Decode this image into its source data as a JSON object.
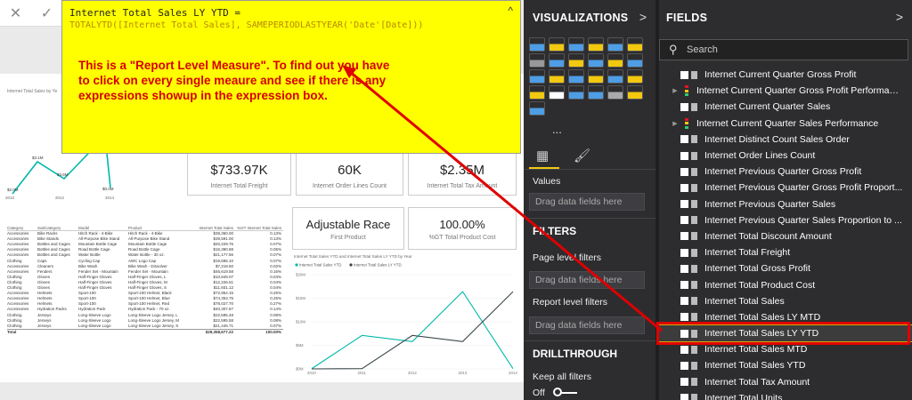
{
  "formula_bar": {
    "cancel_icon": "✕",
    "commit_icon": "✓",
    "line1": "Internet Total Sales LY YTD =",
    "line2": "TOTALYTD([Internet Total Sales], SAMEPERIODLASTYEAR('Date'[Date]))",
    "collapse_icon": "^"
  },
  "annotation": "This is a \"Report Level Measure\". To find out you have to click on every single meaure and see if there is any expressions showup in the expression box.",
  "cards": [
    {
      "value": "$733.97K",
      "caption": "Internet Total Freight"
    },
    {
      "value": "60K",
      "caption": "Internet Order Lines Count"
    },
    {
      "value": "$2.35M",
      "caption": "Internet Total Tax Amount"
    },
    {
      "value": "Adjustable Race",
      "caption": "First Product"
    },
    {
      "value": "100.00%",
      "caption": "%GT Total Product Cost"
    }
  ],
  "small_chart": {
    "title": "Internet Total Sales by Ye",
    "labels": [
      "$2.0M",
      "$3.1M",
      "$3.6M",
      "$0.0M"
    ],
    "years": [
      "2010",
      "2012",
      "2014"
    ]
  },
  "table": {
    "headers": [
      "Category",
      "SubCategory",
      "Model",
      "Product",
      "Internet Total Sales",
      "%GT Internet Total Sales"
    ],
    "rows": [
      [
        "Accessories",
        "Bike Racks",
        "Hitch Rack - 4-Bike",
        "Hitch Rack - 4-Bike",
        "$39,360.00",
        "0.13%"
      ],
      [
        "Accessories",
        "Bike Stands",
        "All-Purpose Bike Stand",
        "All-Purpose Bike Stand",
        "$39,591.00",
        "0.13%"
      ],
      [
        "Accessories",
        "Bottles and Cages",
        "Mountain Bottle Cage",
        "Mountain Bottle Cage",
        "$20,229.75",
        "0.07%"
      ],
      [
        "Accessories",
        "Bottles and Cages",
        "Road Bottle Cage",
        "Road Bottle Cage",
        "$15,390.88",
        "0.05%"
      ],
      [
        "Accessories",
        "Bottles and Cages",
        "Water Bottle",
        "Water Bottle - 30 oz.",
        "$21,177.56",
        "0.07%"
      ],
      [
        "Clothing",
        "Caps",
        "Cycling Cap",
        "AWC Logo Cap",
        "$19,688.10",
        "0.07%"
      ],
      [
        "Accessories",
        "Cleaners",
        "Bike Wash",
        "Bike Wash - Dissolver",
        "$7,218.60",
        "0.02%"
      ],
      [
        "Accessories",
        "Fenders",
        "Fender Set - Mountain",
        "Fender Set - Mountain",
        "$46,619.58",
        "0.16%"
      ],
      [
        "Clothing",
        "Gloves",
        "Half-Finger Gloves",
        "Half-Finger Gloves, L",
        "$10,849.07",
        "0.04%"
      ],
      [
        "Clothing",
        "Gloves",
        "Half-Finger Gloves",
        "Half-Finger Gloves, M",
        "$12,226.51",
        "0.04%"
      ],
      [
        "Clothing",
        "Gloves",
        "Half-Finger Gloves",
        "Half-Finger Gloves, S",
        "$11,931.12",
        "0.04%"
      ],
      [
        "Accessories",
        "Helmets",
        "Sport-100",
        "Sport-100 Helmet, Black",
        "$72,954.15",
        "0.25%"
      ],
      [
        "Accessories",
        "Helmets",
        "Sport-100",
        "Sport-100 Helmet, Blue",
        "$74,353.75",
        "0.25%"
      ],
      [
        "Accessories",
        "Helmets",
        "Sport-100",
        "Sport-100 Helmet, Red",
        "$78,027.70",
        "0.27%"
      ],
      [
        "Accessories",
        "Hydration Packs",
        "Hydration Pack",
        "Hydration Pack - 70 oz.",
        "$40,307.67",
        "0.14%"
      ],
      [
        "Clothing",
        "Jerseys",
        "Long-Sleeve Logo",
        "Long-Sleeve Logo Jersey, L",
        "$22,595.48",
        "0.08%"
      ],
      [
        "Clothing",
        "Jerseys",
        "Long-Sleeve Logo",
        "Long-Sleeve Logo Jersey, M",
        "$22,595.58",
        "0.08%"
      ],
      [
        "Clothing",
        "Jerseys",
        "Long-Sleeve Logo",
        "Long-Sleeve Logo Jersey, S",
        "$21,445.71",
        "0.07%"
      ]
    ],
    "total_label": "Total",
    "total_sales": "$29,358,677.22",
    "total_pct": "100.00%"
  },
  "chart_data": {
    "type": "line",
    "title": "Internet Total Sales YTD and Internet Total Sales LY YTD by Year",
    "x": [
      "2010",
      "2011",
      "2012",
      "2013",
      "2014"
    ],
    "series": [
      {
        "name": "Internet Total Sales YTD",
        "values": [
          0.05,
          7.1,
          5.8,
          16.4,
          0.05
        ],
        "color": "#01b8aa"
      },
      {
        "name": "Internet Total Sales LY YTD",
        "values": [
          0,
          0.05,
          7.1,
          5.8,
          16.4
        ],
        "color": "#374649"
      }
    ],
    "yticks": [
      "$0M",
      "$5M",
      "$10M",
      "$15M",
      "$20M"
    ],
    "ylim": [
      0,
      20
    ]
  },
  "viz_pane": {
    "title": "VISUALIZATIONS",
    "expand_icon": ">",
    "values_label": "Values",
    "drop_hint": "Drag data fields here",
    "filters_title": "FILTERS",
    "page_filters": "Page level filters",
    "report_filters": "Report level filters",
    "drill_title": "DRILLTHROUGH",
    "keep_filters": "Keep all filters",
    "toggle_state": "Off",
    "ellipsis": "...",
    "icon_colors": [
      "#4e9de5",
      "#f2c811",
      "#4e9de5",
      "#f2c811",
      "#4e9de5",
      "#f2c811",
      "#999",
      "#4e9de5",
      "#f2c811",
      "#4e9de5",
      "#f2c811",
      "#4e9de5",
      "#4e9de5",
      "#f2c811",
      "#4e9de5",
      "#f2c811",
      "#4e9de5",
      "#f2c811",
      "#f2c811",
      "#fff",
      "#4e9de5",
      "#4e9de5",
      "#aaa",
      "#f2c811",
      "#4e9de5"
    ]
  },
  "fields_pane": {
    "title": "FIELDS",
    "expand_icon": ">",
    "search_placeholder": "Search",
    "items": [
      {
        "label": "Internet Current Quarter Gross Profit",
        "kpi": false
      },
      {
        "label": "Internet Current Quarter Gross Profit Performance",
        "kpi": true
      },
      {
        "label": "Internet Current Quarter Sales",
        "kpi": false
      },
      {
        "label": "Internet Current Quarter Sales Performance",
        "kpi": true
      },
      {
        "label": "Internet Distinct Count Sales Order",
        "kpi": false
      },
      {
        "label": "Internet Order Lines Count",
        "kpi": false
      },
      {
        "label": "Internet Previous Quarter Gross Profit",
        "kpi": false
      },
      {
        "label": "Internet Previous Quarter Gross Profit Proport...",
        "kpi": false
      },
      {
        "label": "Internet Previous Quarter Sales",
        "kpi": false
      },
      {
        "label": "Internet Previous Quarter Sales Proportion to ...",
        "kpi": false
      },
      {
        "label": "Internet Total Discount Amount",
        "kpi": false
      },
      {
        "label": "Internet Total Freight",
        "kpi": false
      },
      {
        "label": "Internet Total Gross Profit",
        "kpi": false
      },
      {
        "label": "Internet Total Product Cost",
        "kpi": false
      },
      {
        "label": "Internet Total Sales",
        "kpi": false
      },
      {
        "label": "Internet Total Sales LY MTD",
        "kpi": false
      },
      {
        "label": "Internet Total Sales LY YTD",
        "kpi": false,
        "selected": true
      },
      {
        "label": "Internet Total Sales MTD",
        "kpi": false
      },
      {
        "label": "Internet Total Sales YTD",
        "kpi": false
      },
      {
        "label": "Internet Total Tax Amount",
        "kpi": false
      },
      {
        "label": "Internet Total Units",
        "kpi": false
      }
    ]
  },
  "colors": {
    "accent": "#f2c811",
    "annotation": "#d60000",
    "highlight": "#e00000",
    "pane": "#2d2d30"
  }
}
